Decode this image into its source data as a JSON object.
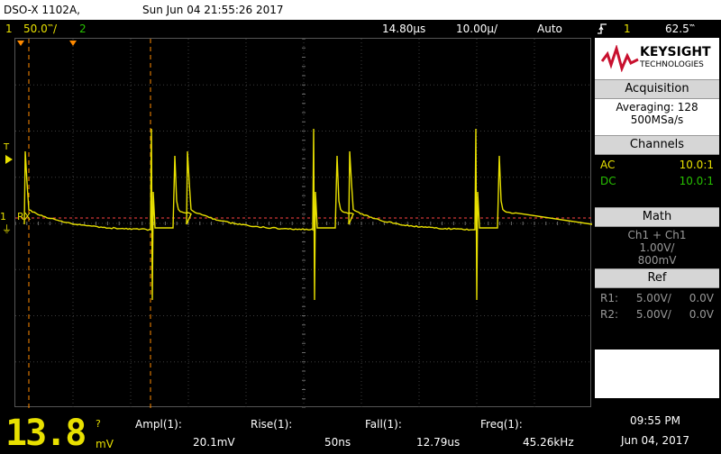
{
  "topbar": {
    "model": "DSO-X 1102A,",
    "datetime": "Sun Jun 04 21:55:26 2017"
  },
  "chbar": {
    "ch1_num": "1",
    "ch1_scale": "50.0‷/",
    "ch2_num": "2",
    "time_offset": "14.80µs",
    "time_scale": "10.00µ/",
    "trigger_mode": "Auto",
    "trigger_icon": "f-trigger-edge-icon",
    "trigger_ch": "1",
    "trigger_level": "62.5‷"
  },
  "scope": {
    "markers": {
      "t": "T",
      "ch1": "1",
      "rx": "RX"
    },
    "colors": {
      "trace": "#e8e000",
      "cursor": "#ff8a00",
      "grid": "#404040",
      "rx_line": "#ff4444"
    }
  },
  "side": {
    "brand": "KEYSIGHT",
    "brand_sub": "TECHNOLOGIES",
    "acq_header": "Acquisition",
    "averaging": "Averaging: 128",
    "rate": "500MSa/s",
    "ch_header": "Channels",
    "ch1_coupling": "AC",
    "ch1_probe": "10.0:1",
    "ch2_coupling": "DC",
    "ch2_probe": "10.0:1",
    "math_header": "Math",
    "math_fn": "Ch1 + Ch1",
    "math_scale": "1.00V/",
    "math_offset": "800mV",
    "ref_header": "Ref",
    "r1_label": "R1:",
    "r1_scale": "5.00V/",
    "r1_offset": "0.0V",
    "r2_label": "R2:",
    "r2_scale": "5.00V/",
    "r2_offset": "0.0V"
  },
  "bottom": {
    "big_value": "13.8",
    "big_unit": "mV",
    "big_flag": "?",
    "ampl_label": "Ampl(1):",
    "ampl_value": "20.1mV",
    "rise_label": "Rise(1):",
    "rise_value": "50ns",
    "fall_label": "Fall(1):",
    "fall_value": "12.79us",
    "freq_label": "Freq(1):",
    "freq_value": "45.26kHz",
    "time": "09:55 PM",
    "date": "Jun 04, 2017"
  }
}
